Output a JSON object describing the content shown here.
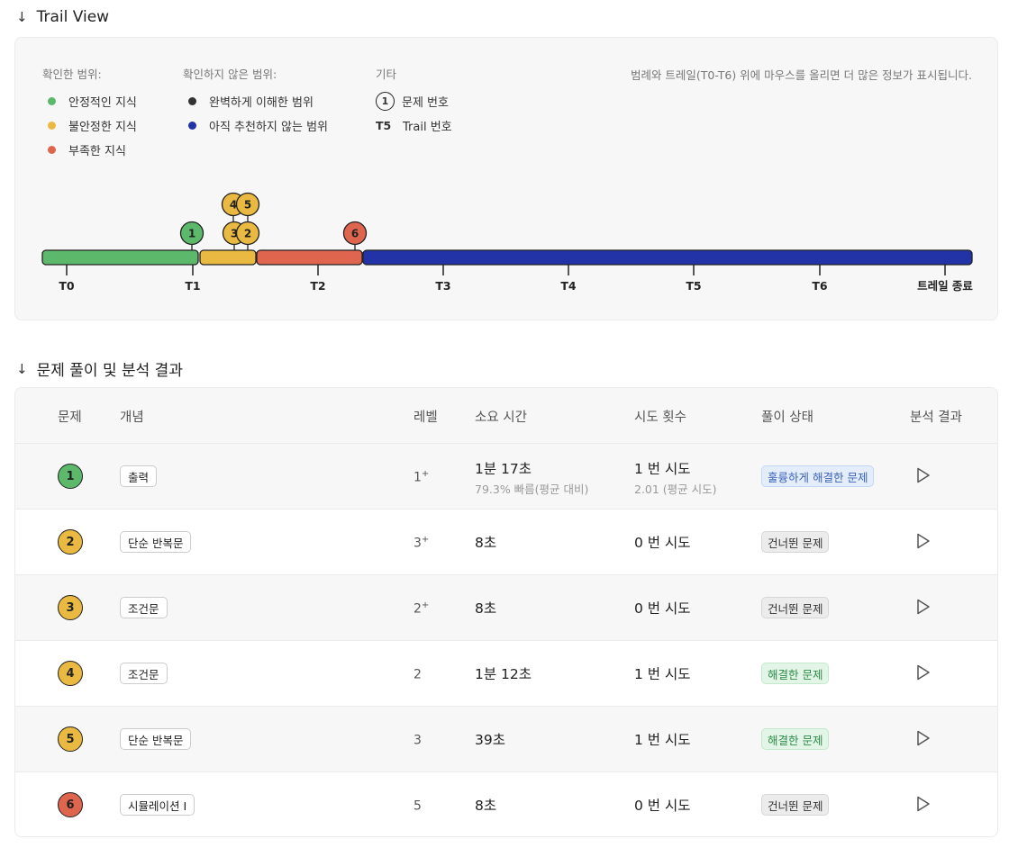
{
  "trail_view": {
    "title": "Trail View",
    "legend": {
      "confirmed_head": "확인한 범위:",
      "confirmed": [
        {
          "label": "안정적인 지식",
          "color": "#5cb96b"
        },
        {
          "label": "불안정한 지식",
          "color": "#e9b941"
        },
        {
          "label": "부족한 지식",
          "color": "#e0654f"
        }
      ],
      "unconfirmed_head": "확인하지 않은 범위:",
      "unconfirmed": [
        {
          "label": "완벽하게 이해한 범위",
          "color": "#333333"
        },
        {
          "label": "아직 추천하지 않는 범위",
          "color": "#2233a8"
        }
      ],
      "etc_head": "기타",
      "etc": [
        {
          "symbol": "1",
          "label": "문제 번호"
        },
        {
          "symbol": "T5",
          "label": "Trail 번호"
        }
      ],
      "hint": "범례와 트레일(T0-T6) 위에 마우스를 올리면 더 많은 정보가 표시됩니다."
    },
    "trail": {
      "segments": [
        {
          "status": "stable",
          "color": "#5cb96b"
        },
        {
          "status": "unstable",
          "color": "#e9b941"
        },
        {
          "status": "lacking",
          "color": "#e0654f"
        },
        {
          "status": "not-recommended",
          "color": "#2233a8"
        }
      ],
      "ticks": [
        "T0",
        "T1",
        "T2",
        "T3",
        "T4",
        "T5",
        "T6",
        "트레일 종료"
      ],
      "markers": [
        {
          "num": "1",
          "color": "#5cb96b"
        },
        {
          "num": "3",
          "color": "#e9b941"
        },
        {
          "num": "2",
          "color": "#e9b941"
        },
        {
          "num": "4",
          "color": "#e9b941"
        },
        {
          "num": "5",
          "color": "#e9b941"
        },
        {
          "num": "6",
          "color": "#e0654f"
        }
      ]
    }
  },
  "results": {
    "title": "문제 풀이 및 분석 결과",
    "headers": {
      "num": "문제",
      "concept": "개념",
      "level": "레벨",
      "time": "소요 시간",
      "attempts": "시도 횟수",
      "status": "풀이 상태",
      "analysis": "분석 결과"
    },
    "rows": [
      {
        "num": "1",
        "color": "#5cb96b",
        "concept": "출력",
        "level": "1",
        "level_sup": "+",
        "time": "1분 17초",
        "time_sub": "79.3% 빠름(평균 대비)",
        "attempts": "1 번 시도",
        "attempts_sub": "2.01 (평균 시도)",
        "status": "훌륭하게 해결한 문제",
        "status_kind": "excellent"
      },
      {
        "num": "2",
        "color": "#e9b941",
        "concept": "단순 반복문",
        "level": "3",
        "level_sup": "+",
        "time": "8초",
        "time_sub": "",
        "attempts": "0 번 시도",
        "attempts_sub": "",
        "status": "건너뛴 문제",
        "status_kind": "skipped"
      },
      {
        "num": "3",
        "color": "#e9b941",
        "concept": "조건문",
        "level": "2",
        "level_sup": "+",
        "time": "8초",
        "time_sub": "",
        "attempts": "0 번 시도",
        "attempts_sub": "",
        "status": "건너뛴 문제",
        "status_kind": "skipped"
      },
      {
        "num": "4",
        "color": "#e9b941",
        "concept": "조건문",
        "level": "2",
        "level_sup": "",
        "time": "1분 12초",
        "time_sub": "",
        "attempts": "1 번 시도",
        "attempts_sub": "",
        "status": "해결한 문제",
        "status_kind": "solved"
      },
      {
        "num": "5",
        "color": "#e9b941",
        "concept": "단순 반복문",
        "level": "3",
        "level_sup": "",
        "time": "39초",
        "time_sub": "",
        "attempts": "1 번 시도",
        "attempts_sub": "",
        "status": "해결한 문제",
        "status_kind": "solved"
      },
      {
        "num": "6",
        "color": "#e0654f",
        "concept": "시뮬레이션 I",
        "level": "5",
        "level_sup": "",
        "time": "8초",
        "time_sub": "",
        "attempts": "0 번 시도",
        "attempts_sub": "",
        "status": "건너뛴 문제",
        "status_kind": "skipped"
      }
    ]
  }
}
